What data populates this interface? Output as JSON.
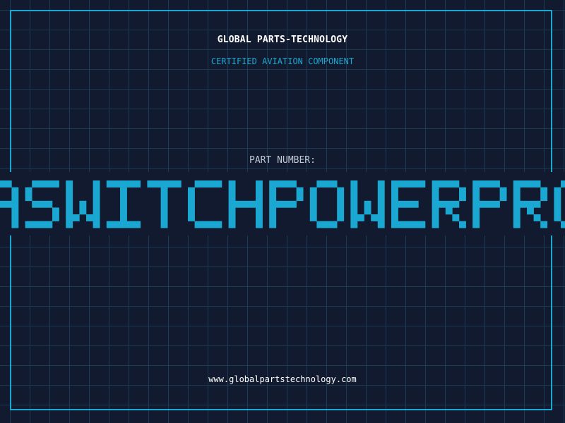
{
  "header": {
    "brand": "GLOBAL PARTS-TECHNOLOGY",
    "subtitle": "CERTIFIED AVIATION COMPONENT"
  },
  "part": {
    "label": "PART NUMBER:",
    "number": "ASWITCHPOWERPRODGU"
  },
  "footer": {
    "url": "www.globalpartstechnology.com"
  },
  "colors": {
    "background": "#111a2e",
    "grid": "#1c3b52",
    "accent": "#1aa8d2",
    "text": "#ffffff",
    "muted": "#c0c8d4"
  }
}
